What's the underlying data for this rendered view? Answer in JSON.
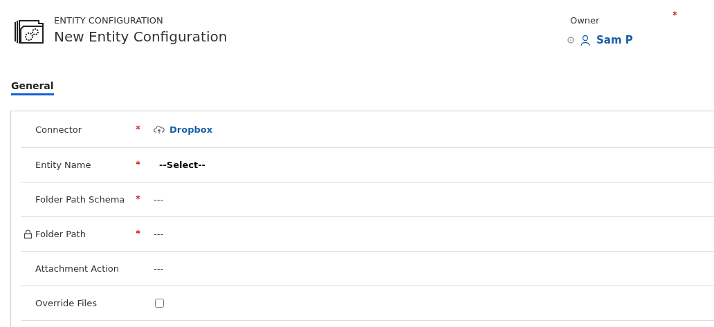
{
  "header": {
    "entity_type": "ENTITY CONFIGURATION",
    "title": "New Entity Configuration"
  },
  "owner": {
    "label": "Owner",
    "required": true,
    "value": "Sam P"
  },
  "tabs": [
    {
      "label": "General",
      "selected": true
    }
  ],
  "fields": [
    {
      "kind": "lookup",
      "label": "Connector",
      "required": true,
      "locked": false,
      "value": "Dropbox"
    },
    {
      "kind": "select",
      "label": "Entity Name",
      "required": true,
      "locked": false,
      "value": "--Select--"
    },
    {
      "kind": "text",
      "label": "Folder Path Schema",
      "required": true,
      "locked": false,
      "value": "---"
    },
    {
      "kind": "text",
      "label": "Folder Path",
      "required": true,
      "locked": true,
      "value": "---"
    },
    {
      "kind": "text",
      "label": "Attachment Action",
      "required": false,
      "locked": false,
      "value": "---"
    },
    {
      "kind": "checkbox",
      "label": "Override Files",
      "required": false,
      "locked": false,
      "checked": false
    }
  ]
}
